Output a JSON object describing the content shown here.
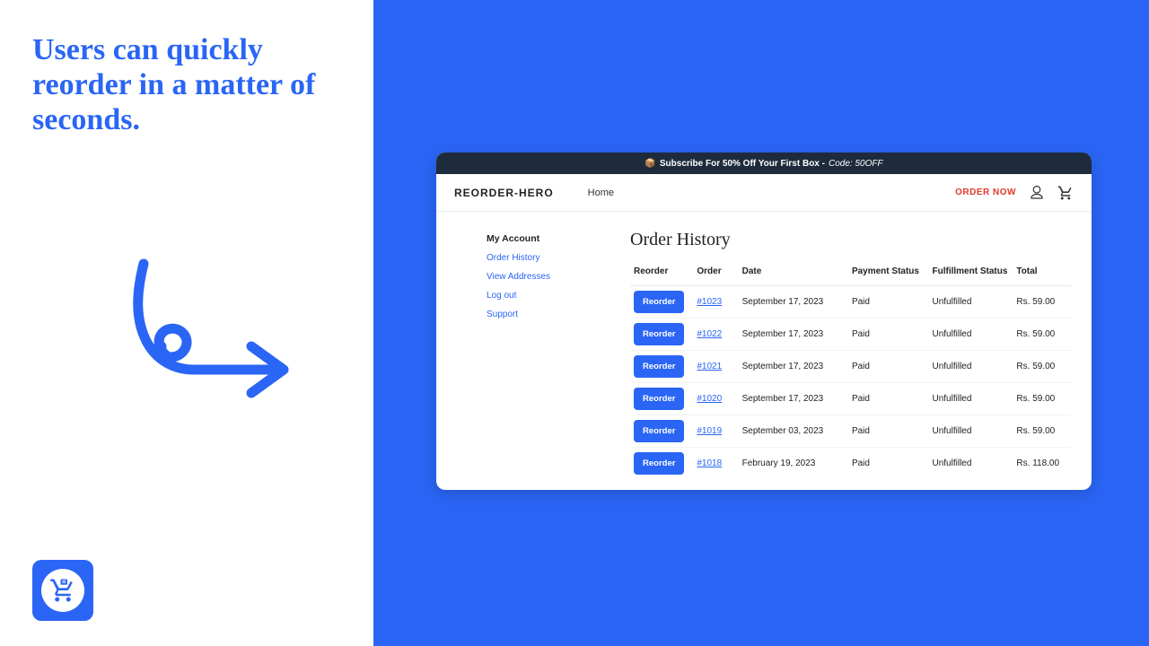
{
  "marketing": {
    "headline": "Users can quickly reorder in a matter of seconds."
  },
  "promo": {
    "emoji": "📦",
    "text": "Subscribe For 50% Off Your First Box -",
    "code": "Code: 50OFF"
  },
  "header": {
    "brand": "REORDER-HERO",
    "nav_home": "Home",
    "order_now": "ORDER NOW"
  },
  "sidebar": {
    "heading": "My Account",
    "links": [
      {
        "label": "Order History"
      },
      {
        "label": "View Addresses"
      },
      {
        "label": "Log out"
      },
      {
        "label": "Support"
      }
    ]
  },
  "page": {
    "title": "Order History",
    "columns": {
      "reorder": "Reorder",
      "order": "Order",
      "date": "Date",
      "payment": "Payment Status",
      "fulfillment": "Fulfillment Status",
      "total": "Total"
    },
    "reorder_label": "Reorder",
    "rows": [
      {
        "order": "#1023",
        "date": "September 17, 2023",
        "payment": "Paid",
        "fulfillment": "Unfulfilled",
        "total": "Rs. 59.00"
      },
      {
        "order": "#1022",
        "date": "September 17, 2023",
        "payment": "Paid",
        "fulfillment": "Unfulfilled",
        "total": "Rs. 59.00"
      },
      {
        "order": "#1021",
        "date": "September 17, 2023",
        "payment": "Paid",
        "fulfillment": "Unfulfilled",
        "total": "Rs. 59.00"
      },
      {
        "order": "#1020",
        "date": "September 17, 2023",
        "payment": "Paid",
        "fulfillment": "Unfulfilled",
        "total": "Rs. 59.00"
      },
      {
        "order": "#1019",
        "date": "September 03, 2023",
        "payment": "Paid",
        "fulfillment": "Unfulfilled",
        "total": "Rs. 59.00"
      },
      {
        "order": "#1018",
        "date": "February 19, 2023",
        "payment": "Paid",
        "fulfillment": "Unfulfilled",
        "total": "Rs. 118.00"
      }
    ]
  }
}
